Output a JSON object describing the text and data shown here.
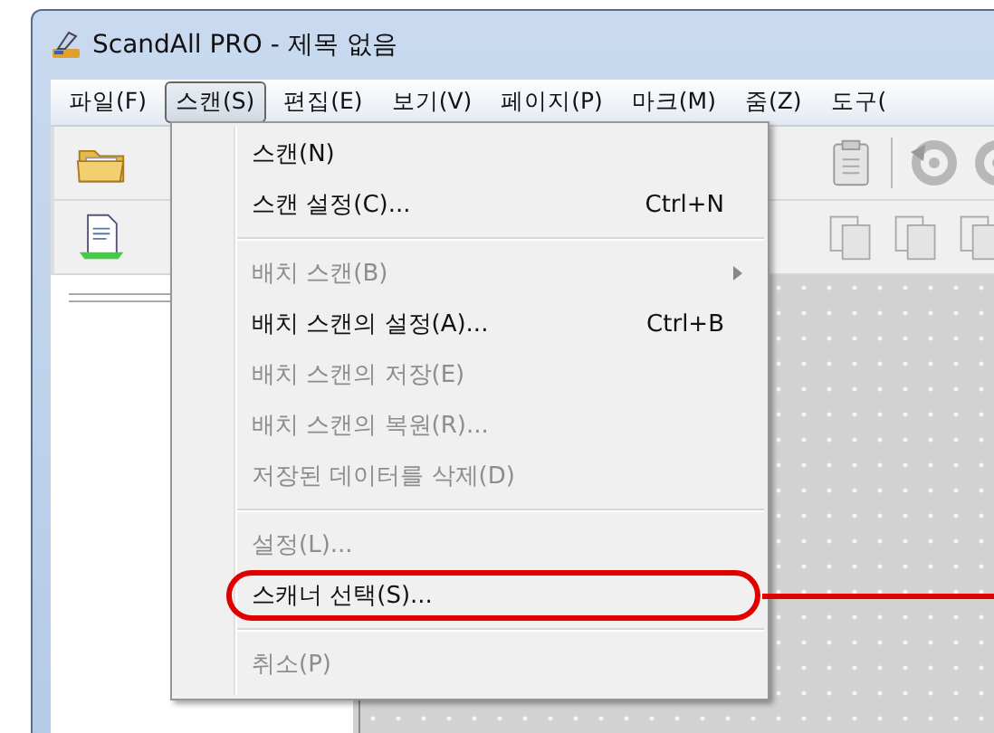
{
  "window": {
    "title": "ScandAll PRO - 제목 없음"
  },
  "menu_bar": [
    {
      "label": "파일(F)",
      "selected": false
    },
    {
      "label": "스캔(S)",
      "selected": true
    },
    {
      "label": "편집(E)",
      "selected": false
    },
    {
      "label": "보기(V)",
      "selected": false
    },
    {
      "label": "페이지(P)",
      "selected": false
    },
    {
      "label": "마크(M)",
      "selected": false
    },
    {
      "label": "줌(Z)",
      "selected": false
    },
    {
      "label": "도구(",
      "selected": false
    }
  ],
  "scan_menu": {
    "items": [
      {
        "kind": "item",
        "label": "스캔(N)",
        "disabled": false,
        "annotated": false
      },
      {
        "kind": "item",
        "label": "스캔 설정(C)...",
        "shortcut": "Ctrl+N",
        "disabled": false,
        "annotated": false
      },
      {
        "kind": "separator"
      },
      {
        "kind": "submenu",
        "label": "배치 스캔(B)",
        "disabled": true,
        "annotated": false
      },
      {
        "kind": "item",
        "label": "배치 스캔의 설정(A)...",
        "shortcut": "Ctrl+B",
        "disabled": false,
        "annotated": false
      },
      {
        "kind": "item",
        "label": "배치 스캔의 저장(E)",
        "disabled": true,
        "annotated": false
      },
      {
        "kind": "item",
        "label": "배치 스캔의 복원(R)...",
        "disabled": true,
        "annotated": false
      },
      {
        "kind": "item",
        "label": "저장된 데이터를 삭제(D)",
        "disabled": true,
        "annotated": false
      },
      {
        "kind": "separator"
      },
      {
        "kind": "item",
        "label": "설정(L)...",
        "disabled": true,
        "annotated": false
      },
      {
        "kind": "item",
        "label": "스캐너 선택(S)...",
        "disabled": false,
        "annotated": true
      },
      {
        "kind": "separator"
      },
      {
        "kind": "item",
        "label": "취소(P)",
        "disabled": true,
        "annotated": false
      }
    ]
  }
}
